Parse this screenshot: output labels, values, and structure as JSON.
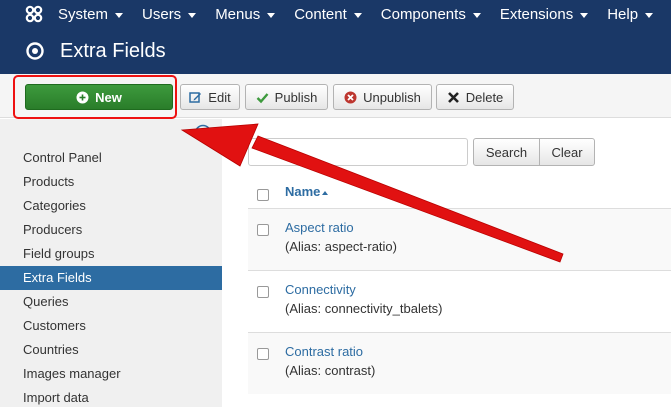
{
  "navbar": {
    "items": [
      {
        "label": "System"
      },
      {
        "label": "Users"
      },
      {
        "label": "Menus"
      },
      {
        "label": "Content"
      },
      {
        "label": "Components"
      },
      {
        "label": "Extensions"
      },
      {
        "label": "Help"
      }
    ]
  },
  "header": {
    "title": "Extra Fields"
  },
  "toolbar": {
    "new_label": "New",
    "edit_label": "Edit",
    "publish_label": "Publish",
    "unpublish_label": "Unpublish",
    "delete_label": "Delete"
  },
  "sidebar": {
    "items": [
      {
        "label": "Control Panel"
      },
      {
        "label": "Products"
      },
      {
        "label": "Categories"
      },
      {
        "label": "Producers"
      },
      {
        "label": "Field groups"
      },
      {
        "label": "Extra Fields",
        "active": true
      },
      {
        "label": "Queries"
      },
      {
        "label": "Customers"
      },
      {
        "label": "Countries"
      },
      {
        "label": "Images manager"
      },
      {
        "label": "Import data"
      }
    ]
  },
  "search": {
    "placeholder": "",
    "value": "",
    "search_label": "Search",
    "clear_label": "Clear"
  },
  "table": {
    "header_name": "Name",
    "rows": [
      {
        "name": "Aspect ratio",
        "alias": "(Alias: aspect-ratio)"
      },
      {
        "name": "Connectivity",
        "alias": "(Alias: connectivity_tbalets)"
      },
      {
        "name": "Contrast ratio",
        "alias": "(Alias: contrast)"
      }
    ]
  },
  "colors": {
    "navbar": "#1a3867",
    "accent": "#2d6ca2",
    "new_button": "#3d9a3d",
    "annotation": "#e11111"
  }
}
